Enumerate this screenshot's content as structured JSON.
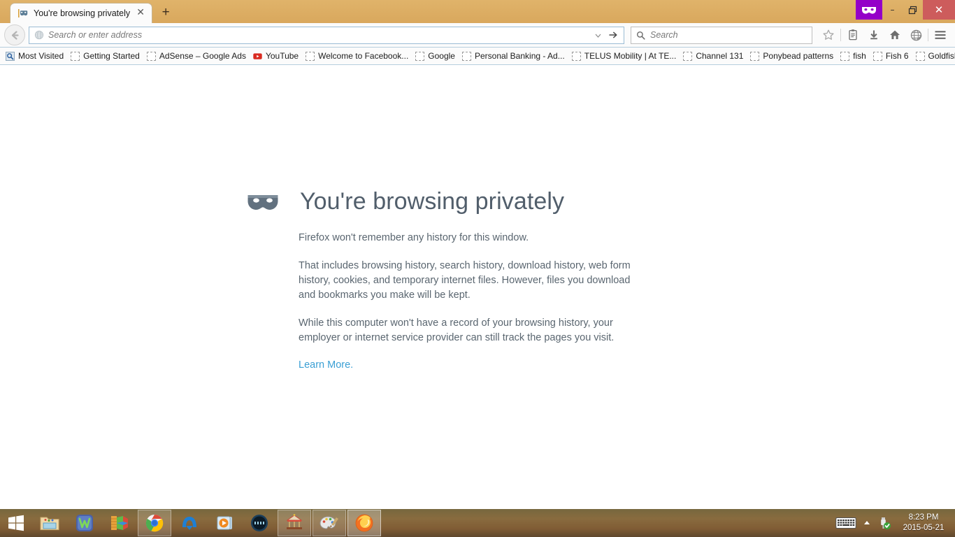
{
  "window": {
    "private_indicator_icon": "mask-icon",
    "minimize_label": "–",
    "restore_label": "❐",
    "close_label": "✕"
  },
  "tabs": [
    {
      "title": "You're browsing privately",
      "favicon": "mask-favicon",
      "close_label": "✕"
    }
  ],
  "new_tab_label": "+",
  "toolbar": {
    "back_icon": "back-arrow-icon",
    "url_icon": "globe-icon",
    "url_placeholder": "Search or enter address",
    "url_dropdown_icon": "chevron-down-icon",
    "url_go_icon": "go-arrow-icon",
    "search_icon": "search-icon",
    "search_placeholder": "Search",
    "icons": [
      {
        "name": "bookmark-star-icon"
      },
      {
        "name": "reader-list-icon"
      },
      {
        "name": "downloads-icon"
      },
      {
        "name": "home-icon"
      },
      {
        "name": "synced-tabs-icon"
      },
      {
        "name": "menu-icon"
      }
    ]
  },
  "bookmarks": {
    "items": [
      {
        "label": "Most Visited",
        "icon": "most-visited-icon"
      },
      {
        "label": "Getting Started",
        "icon": "blank-favicon"
      },
      {
        "label": "AdSense – Google Ads",
        "icon": "blank-favicon"
      },
      {
        "label": "YouTube",
        "icon": "youtube-icon"
      },
      {
        "label": "Welcome to Facebook...",
        "icon": "blank-favicon"
      },
      {
        "label": "Google",
        "icon": "blank-favicon"
      },
      {
        "label": "Personal Banking - Ad...",
        "icon": "blank-favicon"
      },
      {
        "label": "TELUS Mobility | At TE...",
        "icon": "blank-favicon"
      },
      {
        "label": "Channel 131",
        "icon": "blank-favicon"
      },
      {
        "label": "Ponybead patterns",
        "icon": "blank-favicon"
      },
      {
        "label": "fish",
        "icon": "blank-favicon"
      },
      {
        "label": "Fish 6",
        "icon": "blank-favicon"
      },
      {
        "label": "Goldfish",
        "icon": "blank-favicon"
      }
    ],
    "overflow_label": "»"
  },
  "page": {
    "mask_icon": "mask-icon",
    "title": "You're browsing privately",
    "paragraphs": [
      "Firefox won't remember any history for this window.",
      "That includes browsing history, search history, download history, web form history, cookies, and temporary internet files. However, files you download and bookmarks you make will be kept.",
      "While this computer won't have a record of your browsing history, your employer or internet service provider can still track the pages you visit."
    ],
    "link_label": "Learn More.",
    "link_color": "#3a9fd4",
    "title_color": "#515e6b"
  },
  "taskbar": {
    "start_icon": "windows-start-icon",
    "items": [
      {
        "name": "file-explorer",
        "icon": "folder-icon",
        "state": "pinned"
      },
      {
        "name": "wordweb",
        "icon": "w-app-icon",
        "state": "pinned"
      },
      {
        "name": "avast-antivirus",
        "icon": "avast-icon",
        "state": "pinned"
      },
      {
        "name": "google-chrome",
        "icon": "chrome-icon",
        "state": "running"
      },
      {
        "name": "malwarebytes",
        "icon": "m-app-icon",
        "state": "pinned"
      },
      {
        "name": "media-player",
        "icon": "play-icon",
        "state": "pinned"
      },
      {
        "name": "video-app",
        "icon": "film-icon",
        "state": "pinned"
      },
      {
        "name": "carousel-app",
        "icon": "carousel-icon",
        "state": "running"
      },
      {
        "name": "paint",
        "icon": "paint-palette-icon",
        "state": "running"
      },
      {
        "name": "firefox",
        "icon": "firefox-icon",
        "state": "active"
      }
    ],
    "tray": {
      "keyboard_icon": "on-screen-keyboard-icon",
      "hidden_icons_label": "▲",
      "usb_icon": "safely-remove-hardware-icon",
      "time": "8:23 PM",
      "date": "2015-05-21"
    }
  }
}
